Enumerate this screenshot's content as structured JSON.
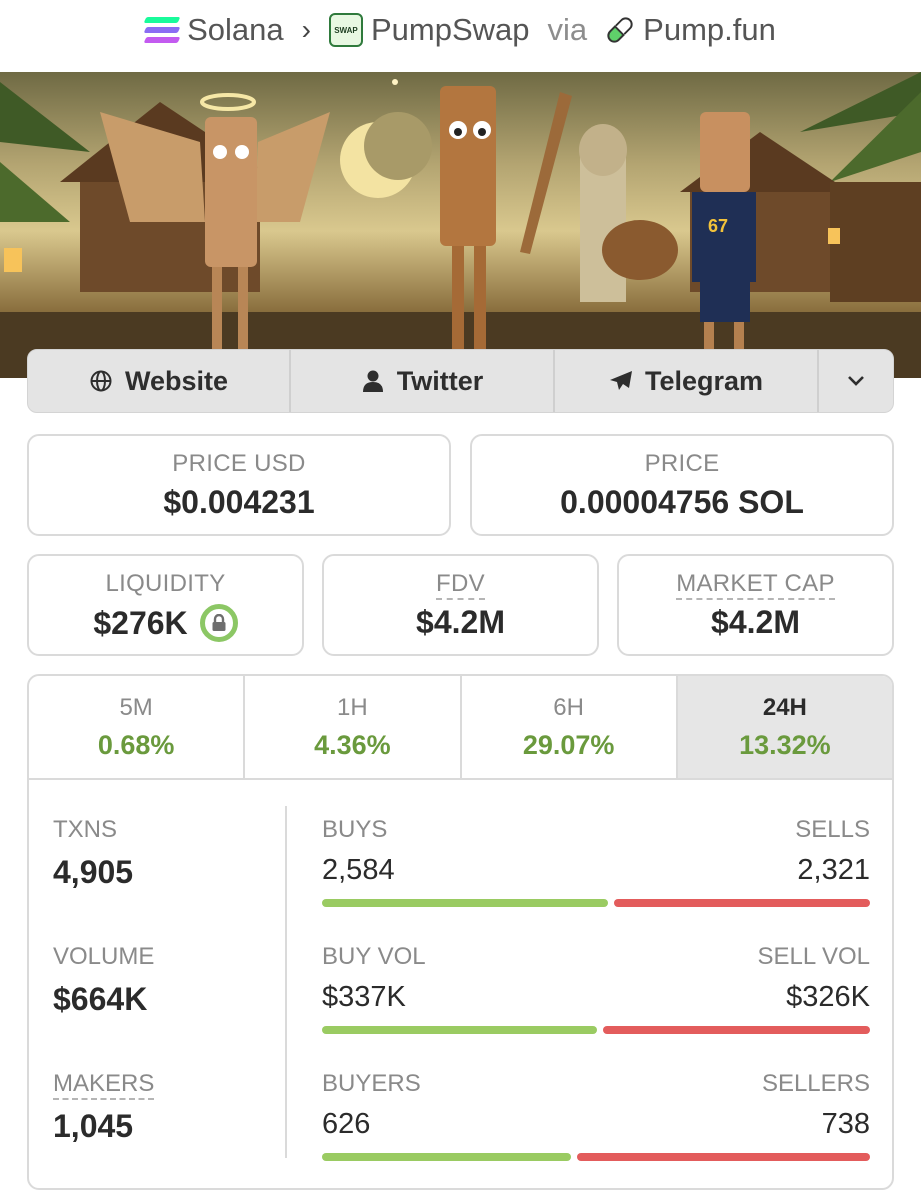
{
  "breadcrumb": {
    "chain": "Solana",
    "dex": "PumpSwap",
    "dex_icon_text": "SWAP",
    "via": "via",
    "launchpad": "Pump.fun"
  },
  "socials": {
    "website": "Website",
    "twitter": "Twitter",
    "telegram": "Telegram"
  },
  "stats": {
    "price_usd_label": "PRICE USD",
    "price_usd": "$0.004231",
    "price_label": "PRICE",
    "price": "0.00004756 SOL",
    "liquidity_label": "LIQUIDITY",
    "liquidity": "$276K",
    "fdv_label": "FDV",
    "fdv": "$4.2M",
    "mcap_label": "MARKET CAP",
    "mcap": "$4.2M"
  },
  "timeframes": [
    {
      "label": "5M",
      "change": "0.68%"
    },
    {
      "label": "1H",
      "change": "4.36%"
    },
    {
      "label": "6H",
      "change": "29.07%"
    },
    {
      "label": "24H",
      "change": "13.32%"
    }
  ],
  "active_timeframe": "24H",
  "activity": {
    "txns_label": "TXNS",
    "txns": "4,905",
    "volume_label": "VOLUME",
    "volume": "$664K",
    "makers_label": "MAKERS",
    "makers": "1,045",
    "buys_label": "BUYS",
    "buys": "2,584",
    "sells_label": "SELLS",
    "sells": "2,321",
    "buy_vol_label": "BUY VOL",
    "buy_vol": "$337K",
    "sell_vol_label": "SELL VOL",
    "sell_vol": "$326K",
    "buyers_label": "BUYERS",
    "buyers": "626",
    "sellers_label": "SELLERS",
    "sellers": "738"
  },
  "ratios": {
    "buys_share": 0.527,
    "buy_vol_share": 0.508,
    "buyers_share": 0.459
  },
  "colors": {
    "positive": "#6a9a3d",
    "buy_bar": "#9acb62",
    "sell_bar": "#e35c5c"
  }
}
